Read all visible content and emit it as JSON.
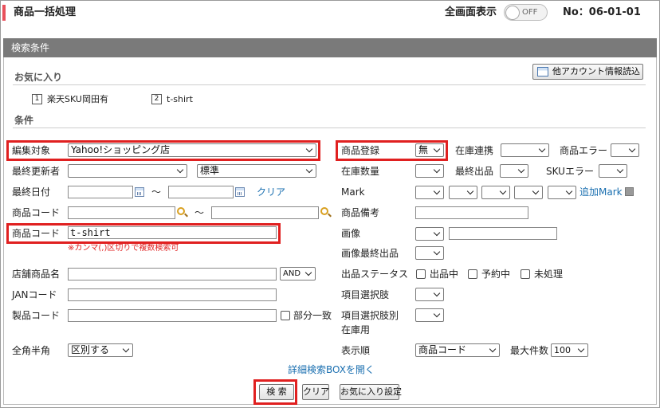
{
  "header": {
    "title": "商品一括処理",
    "fullscreen_label": "全画面表示",
    "toggle_state": "OFF",
    "page_no": "No：06-01-01"
  },
  "panel": {
    "title": "検索条件"
  },
  "favorites": {
    "heading": "お気に入り",
    "other_account_button": "他アカウント情報読込",
    "items": [
      {
        "num": "1",
        "label": "楽天SKU岡田有"
      },
      {
        "num": "2",
        "label": "t-shirt"
      }
    ]
  },
  "conditions": {
    "heading": "条件"
  },
  "left": {
    "edit_target_label": "編集対象",
    "edit_target_value": "Yahoo!ショッピング店",
    "last_updater_label": "最終更新者",
    "last_updater_value": "",
    "last_updater_mode": "標準",
    "last_date_label": "最終日付",
    "tilde": "〜",
    "clear_link": "クリア",
    "product_code_label": "商品コード",
    "product_code2_label": "商品コード",
    "product_code2_value": "t-shirt",
    "comma_hint": "※カンマ(,)区切りで複数検索可",
    "shop_name_label": "店舗商品名",
    "shop_name_op": "AND",
    "jan_label": "JANコード",
    "maker_code_label": "製品コード",
    "partial_match_label": "部分一致",
    "width_label": "全角半角",
    "width_value": "区別する"
  },
  "right": {
    "product_reg_label": "商品登録",
    "product_reg_value": "無",
    "stock_link_label": "在庫連携",
    "product_error_label": "商品エラー",
    "stock_qty_label": "在庫数量",
    "last_listing_label": "最終出品",
    "sku_error_label": "SKUエラー",
    "mark_label": "Mark",
    "add_mark_link": "追加Mark",
    "product_note_label": "商品備考",
    "image_label": "画像",
    "image_last_listing_label": "画像最終出品",
    "listing_status_label": "出品ステータス",
    "status_listed": "出品中",
    "status_reserved": "予約中",
    "status_unprocessed": "未処理",
    "item_choice_label": "項目選択肢",
    "item_choice_stock_label_1": "項目選択肢別",
    "item_choice_stock_label_2": "在庫用",
    "display_order_label": "表示順",
    "display_order_value": "商品コード",
    "max_count_label": "最大件数",
    "max_count_value": "100"
  },
  "detail_box_link": "詳細検索BOXを開く",
  "buttons": {
    "search": "検 索",
    "clear": "クリア",
    "favorite_set": "お気に入り設定"
  },
  "colors": {
    "accent_bar": "#e8505b",
    "panel_header": "#7a7a7a",
    "highlight": "#e02020",
    "link": "#1a6fb0"
  }
}
